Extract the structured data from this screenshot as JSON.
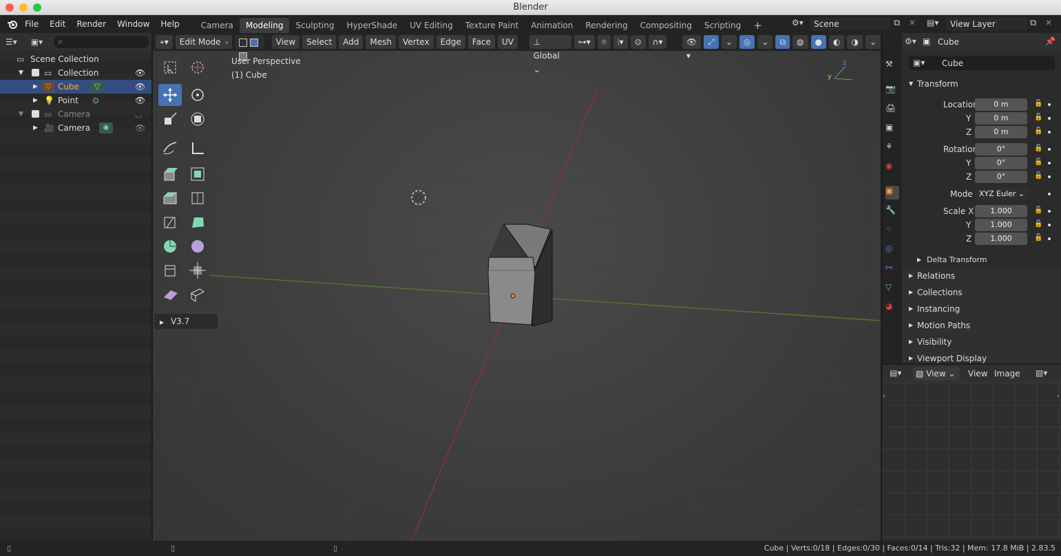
{
  "window": {
    "title": "Blender"
  },
  "menu": [
    "File",
    "Edit",
    "Render",
    "Window",
    "Help"
  ],
  "workspaces": [
    {
      "label": "Camera",
      "active": false
    },
    {
      "label": "Modeling",
      "active": true
    },
    {
      "label": "Sculpting",
      "active": false
    },
    {
      "label": "HyperShade",
      "active": false
    },
    {
      "label": "UV Editing",
      "active": false
    },
    {
      "label": "Texture Paint",
      "active": false
    },
    {
      "label": "Animation",
      "active": false
    },
    {
      "label": "Rendering",
      "active": false
    },
    {
      "label": "Compositing",
      "active": false
    },
    {
      "label": "Scripting",
      "active": false
    }
  ],
  "add_workspace": "+",
  "scene": {
    "name": "Scene"
  },
  "view_layer": {
    "name": "View Layer"
  },
  "outliner": {
    "search_placeholder": "",
    "root": "Scene Collection",
    "items": [
      {
        "label": "Collection",
        "type": "collection",
        "selected": false
      },
      {
        "label": "Cube",
        "type": "mesh",
        "selected": true
      },
      {
        "label": "Point",
        "type": "light",
        "selected": false
      },
      {
        "label": "Camera",
        "type": "collection",
        "selected": false
      },
      {
        "label": "Camera",
        "type": "camera",
        "selected": false
      }
    ]
  },
  "viewport": {
    "mode": "Edit Mode",
    "menus": [
      "View",
      "Select",
      "Add",
      "Mesh",
      "Vertex",
      "Edge",
      "Face",
      "UV"
    ],
    "orientation": "Global",
    "overlay_title": "User Perspective",
    "overlay_object": "(1) Cube",
    "gizmo_labels": {
      "z": "z",
      "y": "y"
    },
    "redo_panel": "V3.7"
  },
  "properties": {
    "object_name": "Cube",
    "data_name": "Cube",
    "transform_title": "Transform",
    "location": {
      "label": "Location X",
      "x": "0 m",
      "y": "0 m",
      "z": "0 m"
    },
    "rotation": {
      "label": "Rotation X",
      "x": "0°",
      "y": "0°",
      "z": "0°"
    },
    "mode": {
      "label": "Mode",
      "value": "XYZ Euler"
    },
    "scale": {
      "label": "Scale X",
      "x": "1.000",
      "y": "1.000",
      "z": "1.000"
    },
    "axis_y": "Y",
    "axis_z": "Z",
    "delta": "Delta Transform",
    "panels": [
      "Relations",
      "Collections",
      "Instancing",
      "Motion Paths",
      "Visibility",
      "Viewport Display"
    ]
  },
  "image_editor": {
    "view_menu": "View",
    "menus": [
      "View",
      "Image"
    ]
  },
  "status": {
    "text": "Cube | Verts:0/18 | Edges:0/30 | Faces:0/14 | Tris:32 | Mem: 17.8 MiB | 2.83.5"
  },
  "colors": {
    "accent": "#4772b3",
    "selected_row": "#334d80",
    "cube_orange": "#e0892a",
    "x_axis": "#b03030",
    "y_axis": "#5a8a2a"
  }
}
